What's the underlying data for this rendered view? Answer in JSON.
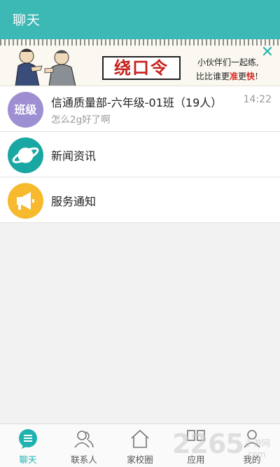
{
  "header": {
    "title": "聊天"
  },
  "banner": {
    "headline": "绕口令",
    "line1": "小伙伴们一起练,",
    "line2_prefix": "比比谁更",
    "line2_red1": "准",
    "line2_mid": "更",
    "line2_red2": "快",
    "line2_suffix": "!",
    "close_icon": "close-icon",
    "accent": "#26b3b0",
    "headline_color": "#c8201c"
  },
  "chats": [
    {
      "avatar_text": "班级",
      "name": "信通质量部-六年级-01班（19人）",
      "last_message": "怎么2g好了啊",
      "time": "14:22",
      "avatar_color": "#9d8fd1"
    },
    {
      "icon": "planet-icon",
      "name": "新闻资讯",
      "avatar_color": "#19a7a3"
    },
    {
      "icon": "megaphone-icon",
      "name": "服务通知",
      "avatar_color": "#f7b92d"
    }
  ],
  "tabs": [
    {
      "label": "聊天",
      "icon": "chat-bubble-icon",
      "active": true
    },
    {
      "label": "联系人",
      "icon": "contacts-icon",
      "active": false
    },
    {
      "label": "家校圈",
      "icon": "home-icon",
      "active": false
    },
    {
      "label": "应用",
      "icon": "apps-icon",
      "active": false
    },
    {
      "label": "我的",
      "icon": "profile-icon",
      "active": false
    }
  ],
  "watermark": {
    "big": "2265",
    "small": "手游网",
    "suffix": ".com"
  },
  "colors": {
    "primary": "#3cb8b5",
    "active_tab": "#1fb3b0"
  }
}
